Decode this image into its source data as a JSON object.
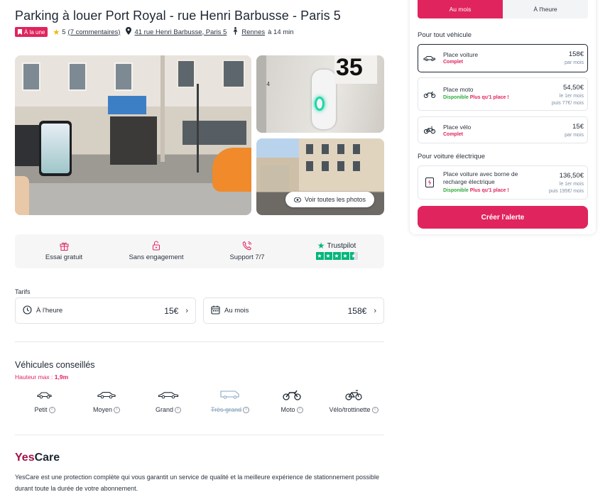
{
  "header": {
    "title": "Parking à louer Port Royal - rue Henri Barbusse - Paris 5",
    "badge": "À la une",
    "rating": "5",
    "reviews": "(7 commentaires)",
    "address": "41 rue Henri Barbusse, Paris 5",
    "transit_station": "Rennes",
    "transit_time": "à 14 min"
  },
  "gallery": {
    "plate_number": "35",
    "view_all_label": "Voir toutes les photos"
  },
  "features": [
    {
      "label": "Essai gratuit",
      "icon": "gift-icon"
    },
    {
      "label": "Sans engagement",
      "icon": "lock-open-icon"
    },
    {
      "label": "Support 7/7",
      "icon": "phone-icon"
    },
    {
      "label": "Trustpilot",
      "icon": "trustpilot-star-icon"
    }
  ],
  "tarifs": {
    "label": "Tarifs",
    "items": [
      {
        "label": "À l'heure",
        "price": "15€",
        "icon": "clock-icon"
      },
      {
        "label": "Au mois",
        "price": "158€",
        "icon": "calendar-icon"
      }
    ]
  },
  "vehicles": {
    "title": "Véhicules conseillés",
    "height_label": "Hauteur max :",
    "height_value": "1,9m",
    "items": [
      {
        "label": "Petit",
        "icon": "small-car-icon",
        "disabled": false
      },
      {
        "label": "Moyen",
        "icon": "medium-car-icon",
        "disabled": false
      },
      {
        "label": "Grand",
        "icon": "large-car-icon",
        "disabled": false
      },
      {
        "label": "Très grand",
        "icon": "van-icon",
        "disabled": true
      },
      {
        "label": "Moto",
        "icon": "motorcycle-icon",
        "disabled": false
      },
      {
        "label": "Vélo/trottinette",
        "icon": "bicycle-icon",
        "disabled": false
      }
    ]
  },
  "yescare": {
    "brand_part1": "Yes",
    "brand_part2": "Care",
    "text": "YesCare est une protection complète qui vous garantit un service de qualité et la meilleure expérience de stationnement possible durant toute la durée de votre abonnement."
  },
  "panel": {
    "tabs": [
      {
        "label": "Au mois",
        "active": true
      },
      {
        "label": "À l'heure",
        "active": false
      }
    ],
    "section_all": "Pour tout véhicule",
    "section_electric": "Pour voiture électrique",
    "cards": [
      {
        "name": "Place voiture",
        "status": "Complet",
        "status_type": "full",
        "price": "158€",
        "sub": "par mois",
        "icon": "car-icon"
      },
      {
        "name": "Place moto",
        "status": "Disponible",
        "status_extra": "Plus qu'1 place !",
        "status_type": "available",
        "price": "54,50€",
        "sub": "le 1er mois",
        "sub2": "puis 77€/ mois",
        "icon": "motorcycle-icon"
      },
      {
        "name": "Place vélo",
        "status": "Complet",
        "status_type": "full",
        "price": "15€",
        "sub": "par mois",
        "icon": "bicycle-icon"
      },
      {
        "name": "Place voiture avec borne de recharge électrique",
        "status": "Disponible",
        "status_extra": "Plus qu'1 place !",
        "status_type": "available",
        "price": "136,50€",
        "sub": "le 1er mois",
        "sub2": "puis 195€/ mois",
        "icon": "ev-charger-icon"
      }
    ],
    "cta": "Créer l'alerte"
  },
  "colors": {
    "brand_pink": "#e0245e",
    "available_green": "#2eaa3c",
    "trustpilot_green": "#00b67a",
    "yescare_red": "#a3124a"
  }
}
